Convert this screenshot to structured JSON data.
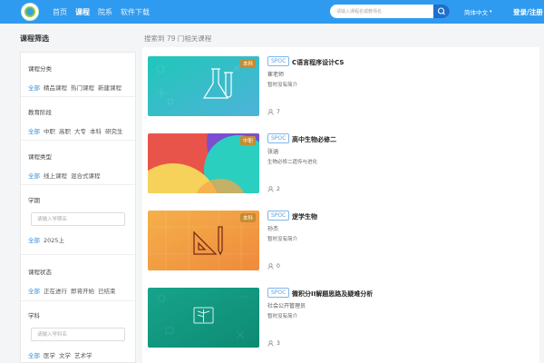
{
  "header": {
    "nav": [
      {
        "label": "首页",
        "active": false
      },
      {
        "label": "课程",
        "active": true
      },
      {
        "label": "院系",
        "active": false
      },
      {
        "label": "软件下载",
        "active": false
      }
    ],
    "search_placeholder": "请输入课程名或教师名",
    "language": "简体中文",
    "login": "登录/注册",
    "colors": {
      "bar": "#2f9bf0",
      "search_button": "#1e6fcd"
    }
  },
  "sidebar": {
    "title": "课程筛选",
    "category": {
      "label": "课程分类",
      "options": [
        "全部",
        "精品课程",
        "热门课程",
        "新建课程"
      ]
    },
    "stage": {
      "label": "教育阶段",
      "options": [
        "全部",
        "中职",
        "高职",
        "大专",
        "本科",
        "研究生"
      ]
    },
    "type": {
      "label": "课程类型",
      "options": [
        "全部",
        "线上课程",
        "混合式课程"
      ]
    },
    "term": {
      "label": "学期",
      "placeholder": "请输入学期名",
      "options": [
        "全部",
        "2025上"
      ]
    },
    "status": {
      "label": "课程状态",
      "options": [
        "全部",
        "正在进行",
        "即将开始",
        "已结束"
      ]
    },
    "subject": {
      "label": "学科",
      "placeholder": "请输入学科名",
      "options": [
        "全部",
        "医学",
        "文学",
        "艺术学"
      ]
    }
  },
  "main": {
    "result_count": "搜索到 79 门相关课程",
    "courses": [
      {
        "badge": "SPOC",
        "tag": "本科",
        "title": "C语言程序设计CS",
        "teacher": "崔老师",
        "desc": "暂时没有简介",
        "count": "7",
        "thumb_icon": "flask-icon"
      },
      {
        "badge": "SPOC",
        "tag": "中职",
        "title": "高中生物必修二",
        "teacher": "张涵",
        "desc": "生物必修二遗传与进化",
        "count": "2",
        "thumb_icon": "none"
      },
      {
        "badge": "SPOC",
        "tag": "本科",
        "title": "逻学生物",
        "teacher": "孙杰",
        "desc": "暂时没有简介",
        "count": "0",
        "thumb_icon": "ruler-icon"
      },
      {
        "badge": "SPOC",
        "tag": "",
        "title": "微积分II解题思路及疑难分析",
        "teacher": "社会公开管理员",
        "desc": "暂时没有简介",
        "count": "3",
        "thumb_icon": "book-icon"
      }
    ]
  }
}
